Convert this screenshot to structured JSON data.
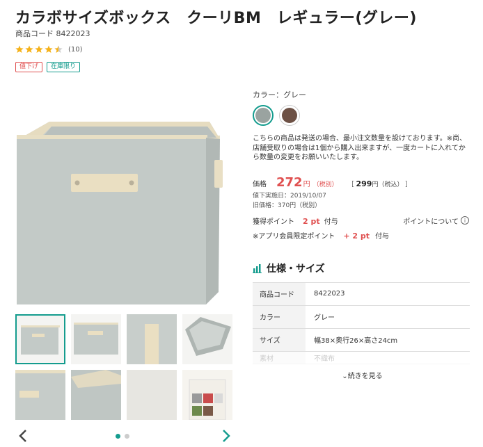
{
  "product": {
    "title": "カラボサイズボックス　クーリBM　レギュラー(グレー)",
    "code_line": "商品コード 8422023",
    "review_count": "(10)",
    "rating": 4.5,
    "badges": [
      "値下げ",
      "在庫限り"
    ]
  },
  "color": {
    "label": "カラー：グレー",
    "swatches": [
      "#9aa3a0",
      "#6d5145"
    ]
  },
  "notice": "こちらの商品は発送の場合、最小注文数量を設けております。※尚、店舗受取りの場合は1個から購入出来ますが、一度カートに入れてから数量の変更をお願いいたします。",
  "price": {
    "label": "価格",
    "value": "272",
    "unit": "円",
    "tax_note": "（税別）",
    "incl_open": "［",
    "incl_value": "299",
    "incl_note": "円（税込）",
    "incl_close": "］",
    "reduced_date": "値下実施日：2019/10/07",
    "old_price": "旧価格：370円（税別）"
  },
  "points": {
    "label": "獲得ポイント",
    "value": "2 pt",
    "suffix": "付与",
    "about": "ポイントについて",
    "app_label": "※アプリ会員限定ポイント",
    "app_value": "+ 2 pt",
    "app_suffix": "付与"
  },
  "spec": {
    "heading": "仕様・サイズ",
    "rows": [
      {
        "key": "商品コード",
        "value": "8422023"
      },
      {
        "key": "カラー",
        "value": "グレー"
      },
      {
        "key": "サイズ",
        "value": "幅38×奥行26×高さ24cm"
      },
      {
        "key": "素材",
        "value": "不織布"
      }
    ],
    "more": "続きを見る"
  },
  "colors": {
    "accent": "#149c8e",
    "price": "#e05050"
  }
}
